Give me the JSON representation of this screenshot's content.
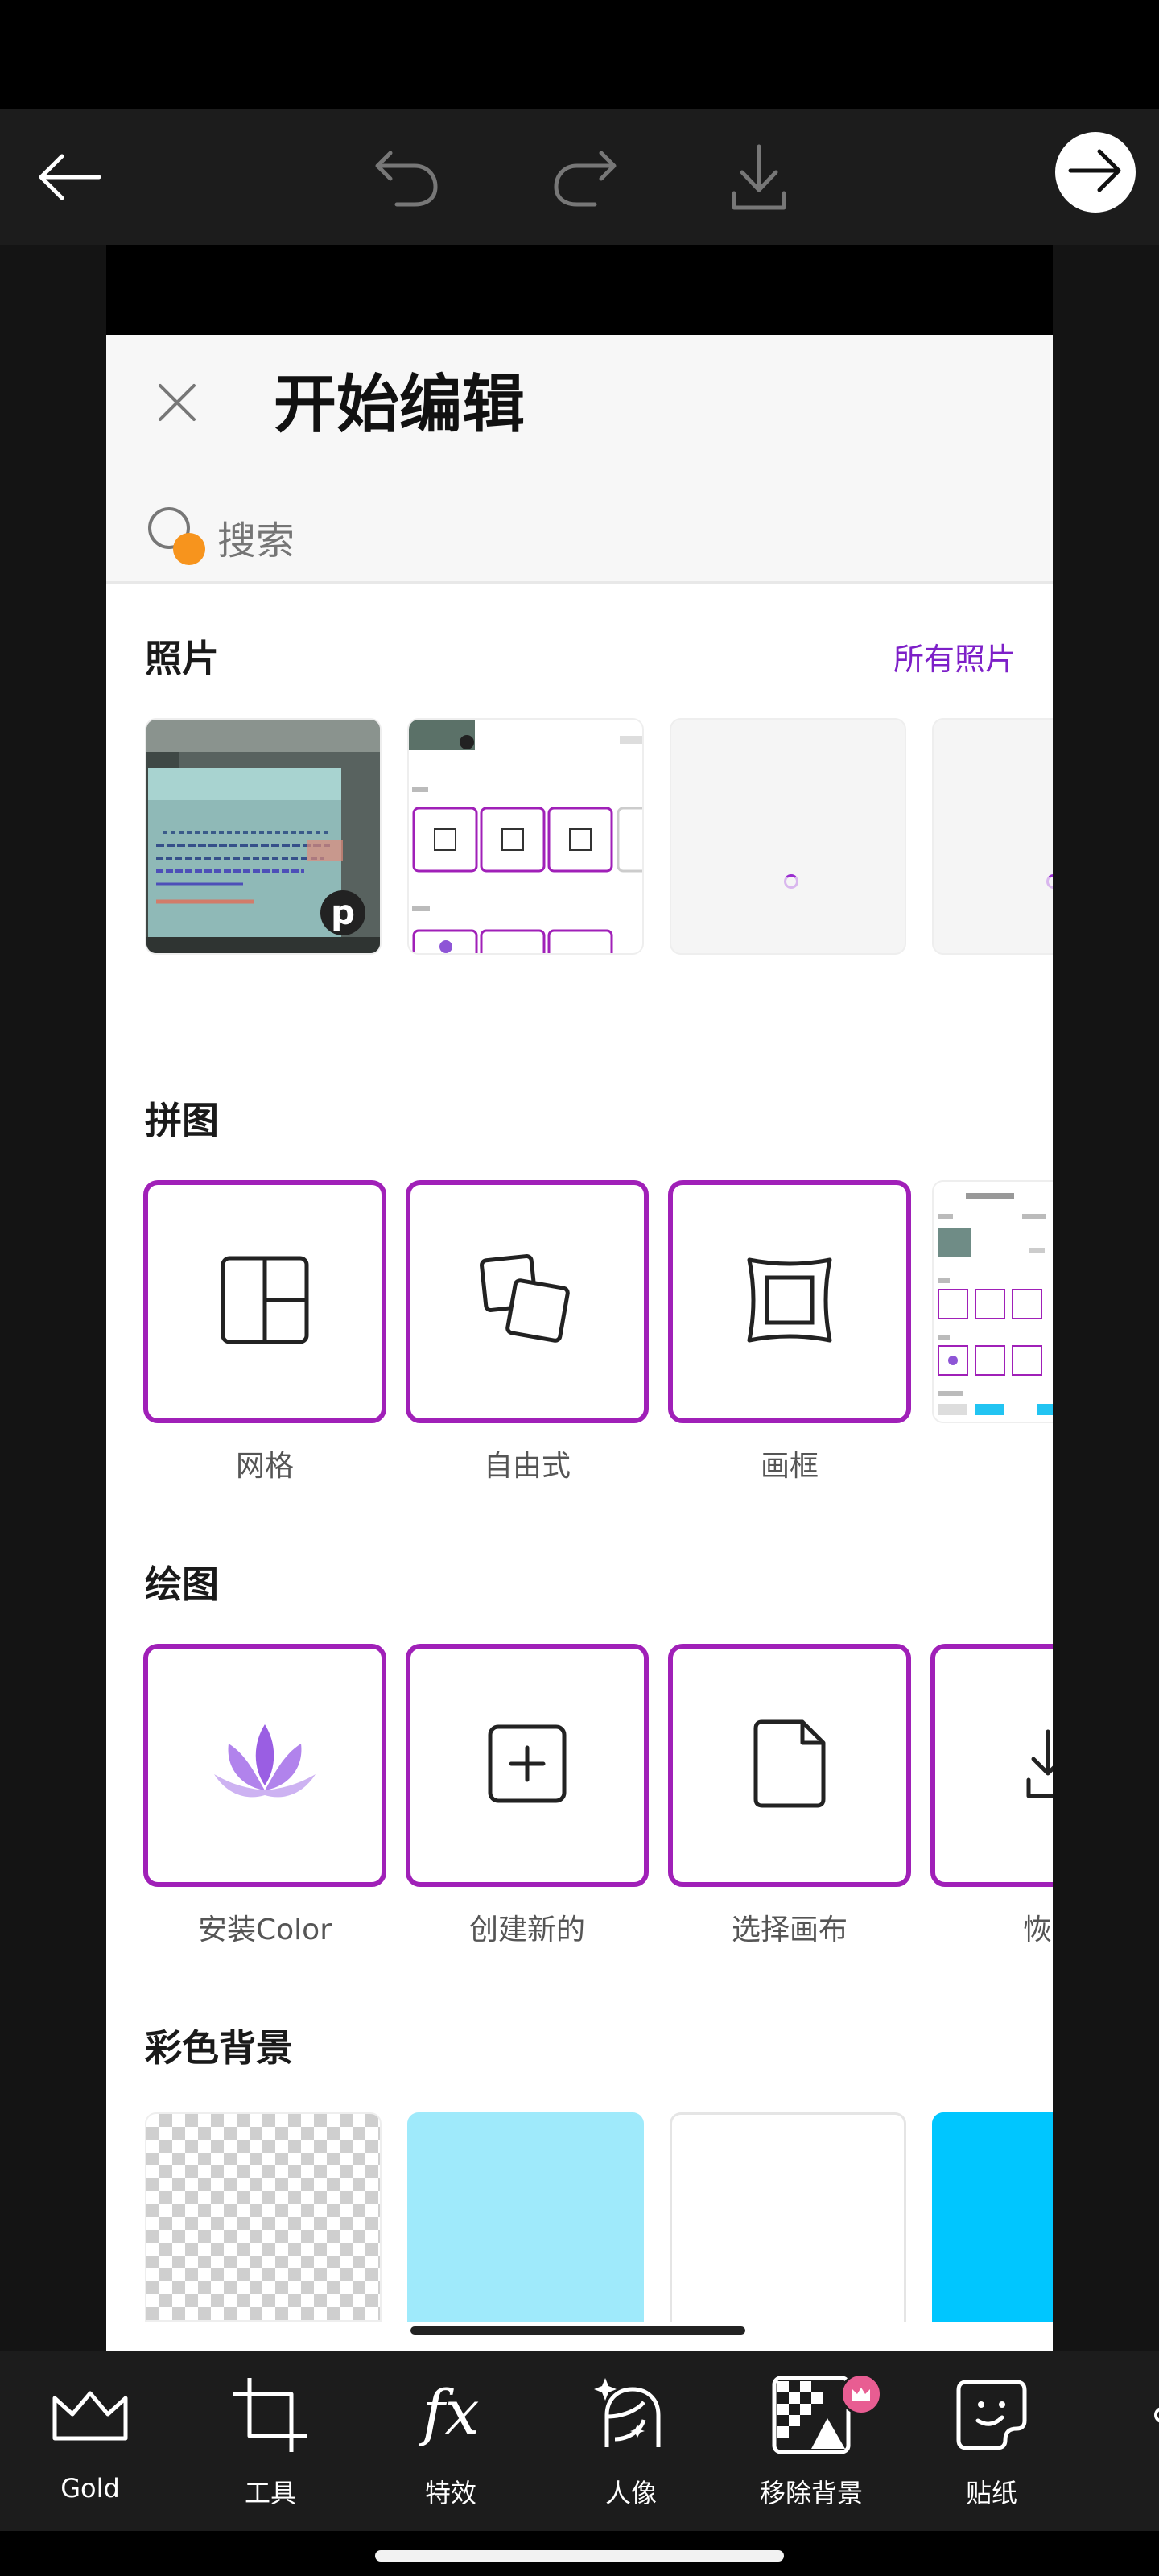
{
  "panel": {
    "title": "开始编辑",
    "search_placeholder": "搜索"
  },
  "photos": {
    "title": "照片",
    "see_all": "所有照片"
  },
  "collage": {
    "title": "拼图",
    "items": [
      {
        "label": "网格",
        "icon": "grid-icon"
      },
      {
        "label": "自由式",
        "icon": "freestyle-icon"
      },
      {
        "label": "画框",
        "icon": "frame-icon"
      }
    ]
  },
  "drawing": {
    "title": "绘图",
    "items": [
      {
        "label": "安装Color",
        "icon": "lotus-icon"
      },
      {
        "label": "创建新的",
        "icon": "plus-square-icon"
      },
      {
        "label": "选择画布",
        "icon": "document-icon"
      },
      {
        "label": "恢复",
        "icon": "restore-icon"
      }
    ]
  },
  "backgrounds": {
    "title": "彩色背景",
    "colors": [
      "transparent",
      "#9feafb",
      "#ffffff",
      "#00c6ff"
    ]
  },
  "toolbar": {
    "items": [
      {
        "label": "Gold",
        "icon": "crown-icon"
      },
      {
        "label": "工具",
        "icon": "crop-icon"
      },
      {
        "label": "特效",
        "icon": "fx-icon"
      },
      {
        "label": "人像",
        "icon": "portrait-icon"
      },
      {
        "label": "移除背景",
        "icon": "remove-background-icon"
      },
      {
        "label": "贴纸",
        "icon": "sticker-icon"
      }
    ]
  },
  "colors": {
    "accent": "#a020b8",
    "link": "#7d1fc8",
    "toolbar_bg": "#1c1c1c",
    "search_badge": "#f7941d"
  }
}
